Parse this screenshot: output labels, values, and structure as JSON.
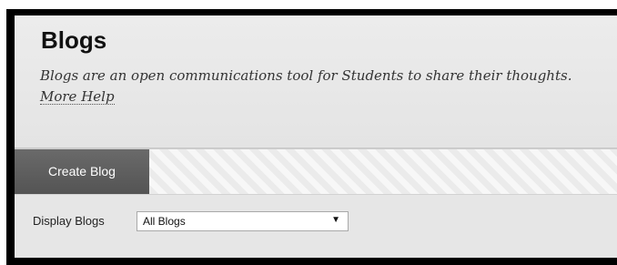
{
  "header": {
    "title": "Blogs",
    "description": "Blogs are an open communications tool for Students to share their thoughts.",
    "help_link": "More Help"
  },
  "action_bar": {
    "create_label": "Create Blog"
  },
  "filter": {
    "label": "Display Blogs",
    "selected_option": "All Blogs",
    "arrow_glyph": "▼"
  },
  "colors": {
    "action_button_bg": "#5e5e5e",
    "frame_border": "#000000",
    "panel_bg": "#ececec"
  }
}
